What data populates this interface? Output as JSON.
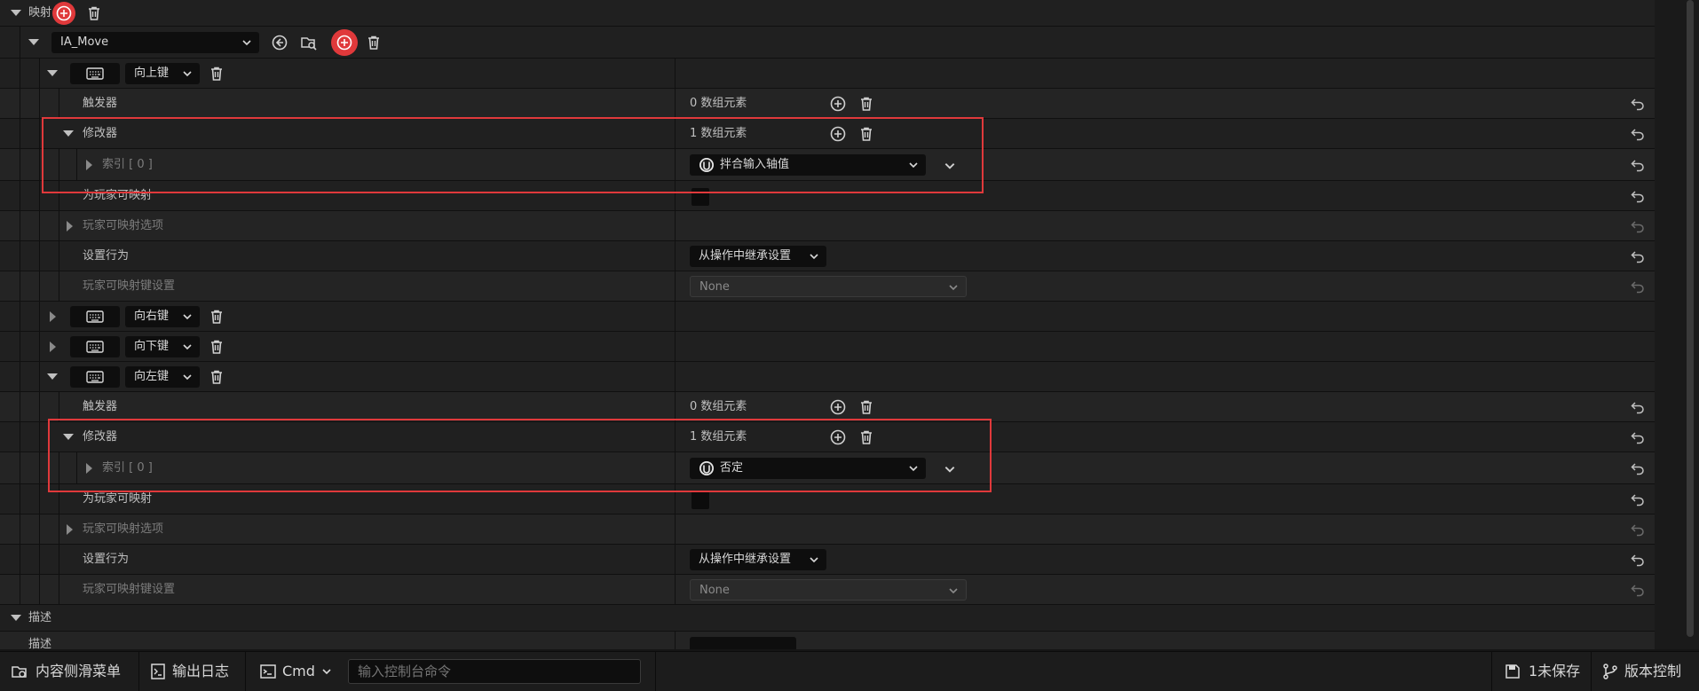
{
  "sections": {
    "mappings": "映射",
    "description": "描述",
    "description_field": "描述"
  },
  "mapping": {
    "action_name": "IA_Move",
    "keys": [
      {
        "label": "向上键"
      },
      {
        "label": "向右键"
      },
      {
        "label": "向下键"
      },
      {
        "label": "向左键"
      }
    ]
  },
  "props": {
    "triggers": "触发器",
    "modifiers": "修改器",
    "index0": "索引 [ 0 ]",
    "player_mappable": "为玩家可映射",
    "player_mappable_options": "玩家可映射选项",
    "setting_behavior": "设置行为",
    "player_mappable_key_settings": "玩家可映射键设置",
    "triggers_count": "0 数组元素",
    "modifiers_count": "1 数组元素",
    "modifier_up": "拌合输入轴值",
    "modifier_left": "否定",
    "behavior_value": "从操作中继承设置",
    "key_settings_value": "None"
  },
  "statusbar": {
    "content_drawer": "内容侧滑菜单",
    "output_log": "输出日志",
    "cmd": "Cmd",
    "console_placeholder": "输入控制台命令",
    "unsaved": "1未保存",
    "source_control": "版本控制"
  },
  "colors": {
    "highlight": "#e0393b",
    "panel": "#1a1a1a",
    "row_light": "#242424",
    "row_dark": "#202020"
  }
}
